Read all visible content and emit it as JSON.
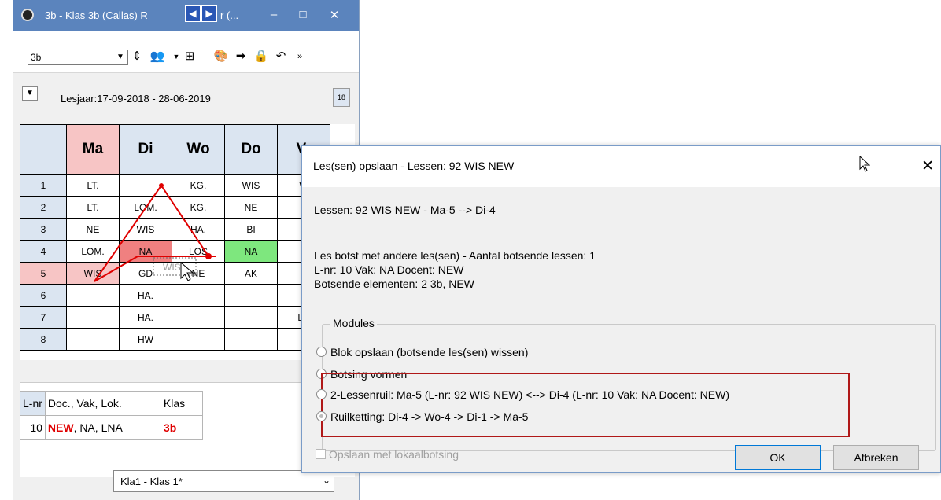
{
  "window": {
    "title": "3b - Klas 3b (Callas)  R",
    "title_suffix": "r (...",
    "controls": {
      "minimize": "–",
      "maximize": "□",
      "close": "✕"
    },
    "nav_arrows": [
      "◀",
      "▶"
    ],
    "class_select": "3b",
    "date_range": "Lesjaar:17-09-2018 - 28-06-2019",
    "calendar_label": "18"
  },
  "timetable": {
    "days": [
      "Ma",
      "Di",
      "Wo",
      "Do",
      "Vr"
    ],
    "rows": [
      {
        "num": "1",
        "cells": [
          "LT.",
          "",
          "KG.",
          "WIS",
          "W"
        ]
      },
      {
        "num": "2",
        "cells": [
          "LT.",
          "LOM.",
          "KG.",
          "NE",
          "A"
        ]
      },
      {
        "num": "3",
        "cells": [
          "NE",
          "WIS",
          "HA.",
          "BI",
          "C"
        ]
      },
      {
        "num": "4",
        "cells": [
          "LOM.",
          "NA",
          "LOS",
          "NA",
          "C"
        ]
      },
      {
        "num": "5",
        "cells": [
          "WIS",
          "GD",
          "NE",
          "AK",
          "I"
        ]
      },
      {
        "num": "6",
        "cells": [
          "",
          "HA.",
          "",
          "",
          "N"
        ]
      },
      {
        "num": "7",
        "cells": [
          "",
          "HA.",
          "",
          "",
          "LC"
        ]
      },
      {
        "num": "8",
        "cells": [
          "",
          "HW",
          "",
          "",
          "N"
        ]
      }
    ],
    "drag_label": "WIS"
  },
  "lesson_table": {
    "headers": [
      "L-nr",
      "Doc., Vak, Lok.",
      "Klas"
    ],
    "row": {
      "lnr": "10",
      "doc_red": "NEW",
      "doc_rest": ", NA, LNA",
      "klas": "3b"
    }
  },
  "bottom_combo": "Kla1 - Klas 1*",
  "dialog": {
    "title": "Les(sen) opslaan - Lessen: 92 WIS NEW",
    "close": "✕",
    "lessons_line": "Lessen: 92 WIS NEW - Ma-5 --> Di-4",
    "conflict_line1": "Les botst met andere les(sen) - Aantal botsende lessen: 1",
    "conflict_line2": "L-nr: 10 Vak: NA Docent: NEW",
    "conflict_line3": "Botsende elementen: 2 3b, NEW",
    "modules_legend": "Modules",
    "options": [
      {
        "label": "Blok opslaan (botsende les(sen) wissen)",
        "selected": false
      },
      {
        "label": "Botsing vormen",
        "selected": false
      },
      {
        "label": "2-Lessenruil: Ma-5 (L-nr: 92 WIS NEW) <--> Di-4 (L-nr: 10 Vak: NA Docent: NEW)",
        "selected": false
      },
      {
        "label": "Ruilketting: Di-4 -> Wo-4 -> Di-1 -> Ma-5",
        "selected": true
      }
    ],
    "checkbox_label": "Opslaan met lokaalbotsing",
    "ok_label": "OK",
    "cancel_label": "Afbreken"
  },
  "colors": {
    "titlebar": "#5b84bd",
    "highlight_border": "#b01818",
    "conflict_red": "#f08080",
    "pink": "#f7c5c5",
    "green": "#7ee77e"
  }
}
